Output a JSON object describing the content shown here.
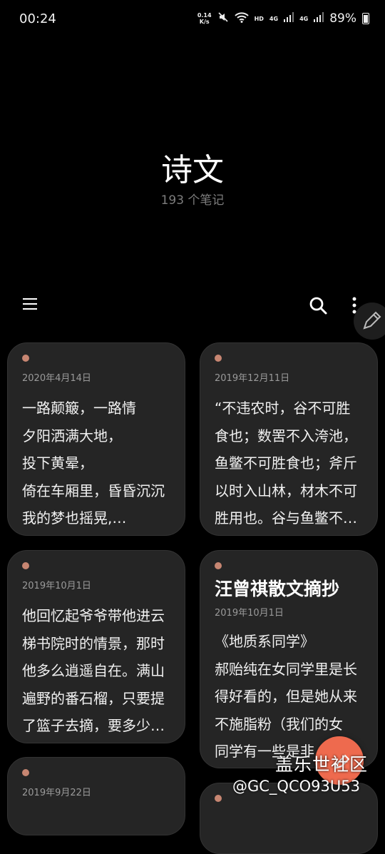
{
  "status_bar": {
    "time": "00:24",
    "net_speed_value": "0.14",
    "net_speed_unit": "K/s",
    "hd_label": "HD",
    "lte_label_1": "4G",
    "lte_label_2": "4G",
    "battery": "89%"
  },
  "header": {
    "title": "诗文",
    "count": "193 个笔记"
  },
  "notes": [
    {
      "date": "2020年4月14日",
      "body": "一路颠簸，一路情\n夕阳洒满大地，\n投下黄晕，\n倚在车厢里，昏昏沉沉\n我的梦也摇晃,…"
    },
    {
      "date": "2019年12月11日",
      "body": "“不违农时，谷不可胜\n食也；数罟不入洿池，\n鱼鳖不可胜食也；斧斤\n以时入山林，材木不可\n胜用也。谷与鱼鳖不…"
    },
    {
      "date": "2019年10月1日",
      "body": "他回忆起爷爷带他进云\n梯书院时的情景，那时\n他多么逍遥自在。满山\n遍野的番石榴，只要提\n了篮子去摘，要多少…"
    },
    {
      "title": "汪曾祺散文摘抄",
      "date": "2019年10月1日",
      "body": "《地质系同学》\n郝贻纯在女同学里是长\n得好看的，但是她从来\n不施脂粉（我们的女\n同学有一些是非"
    },
    {
      "date": "2019年9月22日",
      "body": ""
    }
  ],
  "watermark": {
    "line1": "盖乐世社区",
    "line2": "@GC_QCO93U53"
  },
  "colors": {
    "background": "#000000",
    "card": "#252525",
    "dot": "#c78672",
    "fab": "#ee6a4e"
  },
  "icons": [
    "menu-icon",
    "search-icon",
    "more-vert-icon",
    "pencil-icon",
    "add-icon"
  ]
}
